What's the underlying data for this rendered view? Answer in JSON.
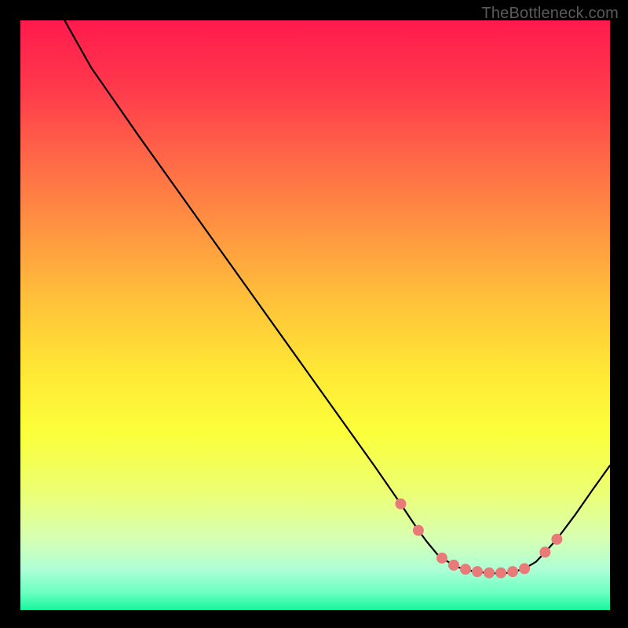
{
  "watermark": "TheBottleneck.com",
  "chart_data": {
    "type": "line",
    "title": "",
    "xlabel": "",
    "ylabel": "",
    "xlim": [
      0,
      100
    ],
    "ylim": [
      0,
      100
    ],
    "background_gradient": {
      "top": "#ff1a4d",
      "mid": "#ffe935",
      "bottom": "#18f79d"
    },
    "series": [
      {
        "name": "curve",
        "color": "#000000",
        "x": [
          7.5,
          12.0,
          20.0,
          30.0,
          40.0,
          50.0,
          60.0,
          64.5,
          67.5,
          69.0,
          71.0,
          74.0,
          77.0,
          80.0,
          83.0,
          85.5,
          87.5,
          89.0,
          91.0,
          94.0,
          97.0,
          100.0
        ],
        "values": [
          100.0,
          92.0,
          80.5,
          66.5,
          52.5,
          38.5,
          24.5,
          18.0,
          13.5,
          11.5,
          9.1,
          7.3,
          6.5,
          6.2,
          6.3,
          7.0,
          8.2,
          9.8,
          12.0,
          16.0,
          20.3,
          24.5
        ]
      },
      {
        "name": "marker-points",
        "color": "#e97a7a",
        "marker": "circle",
        "x": [
          64.5,
          67.5,
          71.5,
          73.5,
          75.5,
          77.5,
          79.5,
          81.5,
          83.5,
          85.5,
          89.0,
          91.0
        ],
        "values": [
          18.0,
          13.5,
          8.8,
          7.6,
          6.9,
          6.5,
          6.3,
          6.3,
          6.5,
          7.0,
          9.8,
          12.0
        ]
      }
    ]
  }
}
